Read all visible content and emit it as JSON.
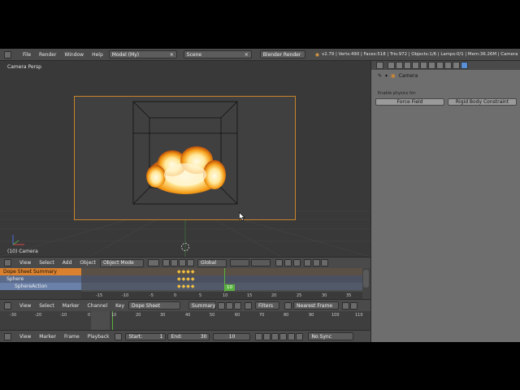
{
  "info_header": {
    "menus": [
      "File",
      "Render",
      "Window",
      "Help"
    ],
    "layout": "Model (My)",
    "scene": "Scene",
    "engine": "Blender Render",
    "stats": "v2.79 | Verts:490 | Faces:518 | Tris:972 | Objects:1/6 | Lamps:0/1 | Mem:36.26M | Camera"
  },
  "viewport": {
    "title": "Camera Persp",
    "info": "(10) Camera"
  },
  "viewport_header": {
    "menus": [
      "View",
      "Select",
      "Add",
      "Object"
    ],
    "mode": "Object Mode",
    "orientation": "Global"
  },
  "dopesheet": {
    "channels": [
      "Dope Sheet Summary",
      "Sphere",
      "SphereAction"
    ],
    "ruler_ticks": [
      "-15",
      "-10",
      "-5",
      "0",
      "5",
      "10",
      "15",
      "20",
      "25",
      "30",
      "35"
    ],
    "current_frame": "10"
  },
  "dopesheet_header": {
    "menus": [
      "View",
      "Select",
      "Marker",
      "Channel",
      "Key"
    ],
    "mode": "Dope Sheet",
    "summary": "Summary",
    "filters": "Filters",
    "snap": "Nearest Frame"
  },
  "timeline": {
    "ticks": [
      "-30",
      "-20",
      "-10",
      "0",
      "10",
      "20",
      "30",
      "40",
      "50",
      "60",
      "70",
      "80",
      "90",
      "100",
      "110"
    ]
  },
  "timeline_header": {
    "menus": [
      "View",
      "Marker",
      "Frame",
      "Playback"
    ],
    "start_label": "Start:",
    "start_value": "1",
    "end_label": "End:",
    "end_value": "30",
    "frame_value": "10",
    "sync": "No Sync"
  },
  "properties": {
    "path_object": "Camera",
    "physics_label": "Enable physics for:",
    "force_field": "Force Field",
    "rigid_body_constraint": "Rigid Body Constraint"
  },
  "colors": {
    "accent_orange": "#c8832c",
    "selected_channel": "#d9812e",
    "active_tab": "#5a8ed6",
    "frame_green": "#5ab23e"
  }
}
